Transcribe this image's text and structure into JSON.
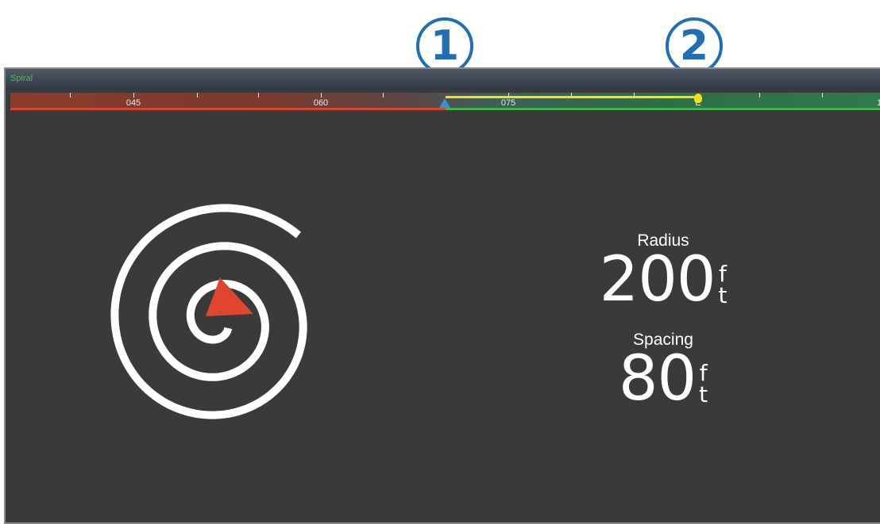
{
  "callouts": [
    "1",
    "2"
  ],
  "screen": {
    "title": "Spiral",
    "compass": {
      "ticks": [
        "045",
        "060",
        "075",
        "E",
        "1"
      ]
    },
    "radius": {
      "label": "Radius",
      "value": "200",
      "unit_top": "f",
      "unit_bottom": "t"
    },
    "spacing": {
      "label": "Spacing",
      "value": "80",
      "unit_top": "f",
      "unit_bottom": "t"
    }
  },
  "colors": {
    "callout": "#1f6fb2",
    "track": "#f2e21a",
    "start_marker": "#3b8fd6",
    "vessel": "#e0452e"
  },
  "icons": [
    "spiral-path-icon",
    "vessel-arrow-icon"
  ]
}
